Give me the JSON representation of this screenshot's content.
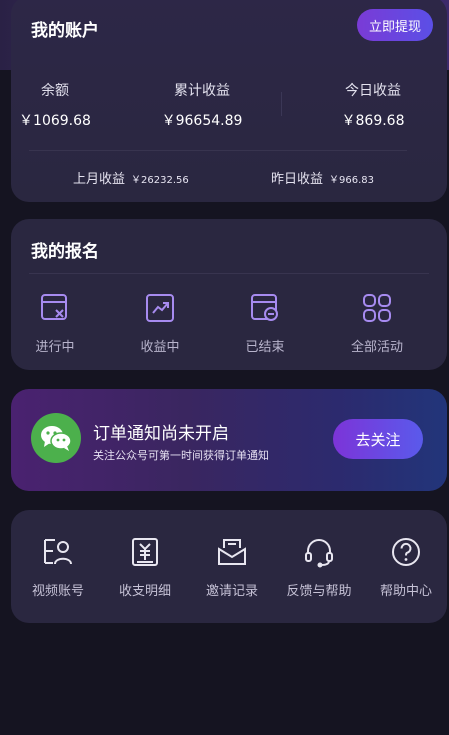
{
  "account": {
    "title": "我的账户",
    "withdraw_label": "立即提现",
    "stats": [
      {
        "label": "余额",
        "value": "￥1069.68"
      },
      {
        "label": "累计收益",
        "value": "￥96654.89"
      },
      {
        "label": "今日收益",
        "value": "￥869.68"
      }
    ],
    "last_month_label": "上月收益",
    "last_month_value": "￥26232.56",
    "yesterday_label": "昨日收益",
    "yesterday_value": "￥966.83"
  },
  "signup": {
    "title": "我的报名",
    "items": [
      {
        "label": "进行中",
        "icon": "in-progress-icon"
      },
      {
        "label": "收益中",
        "icon": "trend-chart-icon"
      },
      {
        "label": "已结束",
        "icon": "ended-icon"
      },
      {
        "label": "全部活动",
        "icon": "grid-apps-icon"
      }
    ]
  },
  "notice": {
    "title": "订单通知尚未开启",
    "subtitle": "关注公众号可第一时间获得订单通知",
    "button_label": "去关注",
    "icon": "wechat-icon"
  },
  "tools": {
    "items": [
      {
        "label": "视频账号",
        "icon": "video-account-icon"
      },
      {
        "label": "收支明细",
        "icon": "ledger-icon"
      },
      {
        "label": "邀请记录",
        "icon": "invite-mail-icon"
      },
      {
        "label": "反馈与帮助",
        "icon": "headset-icon"
      },
      {
        "label": "帮助中心",
        "icon": "help-circle-icon"
      }
    ]
  },
  "colors": {
    "background": "#151421",
    "card": "#2a2740",
    "accent_purple": "#7a3bd6",
    "accent_blue": "#5b4fe6",
    "icon_purple": "#a78bf0",
    "wechat_green": "#4cb04c"
  }
}
